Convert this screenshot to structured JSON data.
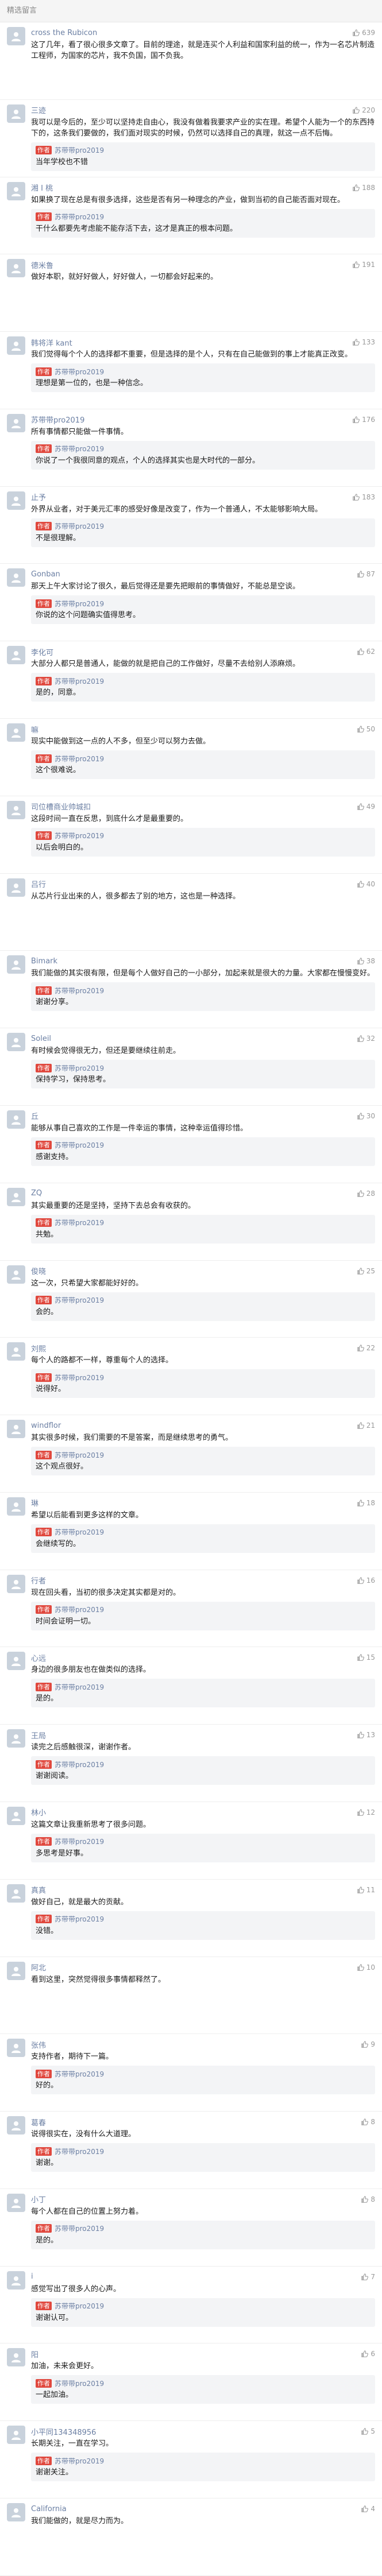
{
  "section_title": "精选留言",
  "reply_author_badge": "作者",
  "colors": {
    "link": "#6b7fa3",
    "badge": "#e0483e",
    "reply_bg": "#f3f4f6"
  },
  "comments": [
    {
      "name": "cross the Rubicon",
      "likes": "639",
      "text": "这了几年，看了很心很多文章了。目前的理途，就是连买个人利益和国家利益的统一，作为一名芯片制造工程师，为国家的芯片，我不负国，国不负我。",
      "reply": null
    },
    {
      "name": "三迹",
      "likes": "220",
      "text": "我可以是今后的，至少可以坚持走自由心，我没有做着我要求产业的实在理。希望个人能为一个的东西持下的，这条我们要做的，我们面对现实的时候，仍然可以选择自己的真理，就这一点不后悔。",
      "reply": {
        "name": "苏带带pro2019",
        "text": "当年学校也不错"
      }
    },
    {
      "name": "湘 I 桃",
      "likes": "188",
      "text": "如果换了现在总是有很多选择，这些是否有另一种理念的产业，做到当初的自己能否面对现在。",
      "reply": {
        "name": "苏带带pro2019",
        "text": "干什么都要先考虑能不能存活下去，这才是真正的根本问题。"
      }
    },
    {
      "name": "德米鲁",
      "likes": "191",
      "text": "做好本职，就好好做人，好好做人，一切都会好起来的。",
      "reply": null
    },
    {
      "name": "韩将洋 kant",
      "likes": "133",
      "text": "我们觉得每个个人的选择都不重要，但是选择的是个人，只有在自己能做到的事上才能真正改变。",
      "reply": {
        "name": "苏带带pro2019",
        "text": "理想是第一位的，也是一种信念。"
      }
    },
    {
      "name": "苏带带pro2019",
      "likes": "176",
      "text": "所有事情都只能做一件事情。",
      "reply": {
        "name": "苏带带pro2019",
        "text": "你说了一个我很同意的观点，个人的选择其实也是大时代的一部分。"
      }
    },
    {
      "name": "止予",
      "likes": "183",
      "text": "外界从业者，对于美元汇率的感受好像是改变了，作为一个普通人，不太能够影响大局。",
      "reply": {
        "name": "苏带带pro2019",
        "text": "不是很理解。"
      }
    },
    {
      "name": "Gonban",
      "likes": "87",
      "text": "那天上午大家讨论了很久，最后觉得还是要先把眼前的事情做好，不能总是空谈。",
      "reply": {
        "name": "苏带带pro2019",
        "text": "你说的这个问题确实值得思考。"
      }
    },
    {
      "name": "李化可",
      "likes": "62",
      "text": "大部分人都只是普通人，能做的就是把自己的工作做好，尽量不去给别人添麻烦。",
      "reply": {
        "name": "苏带带pro2019",
        "text": "是的，同意。"
      }
    },
    {
      "name": "嘛",
      "likes": "50",
      "text": "现实中能做到这一点的人不多，但至少可以努力去做。",
      "reply": {
        "name": "苏带带pro2019",
        "text": "这个很难说。"
      }
    },
    {
      "name": "司位槽商业帅城扣",
      "likes": "49",
      "text": "这段时间一直在反思，到底什么才是最重要的。",
      "reply": {
        "name": "苏带带pro2019",
        "text": "以后会明白的。"
      }
    },
    {
      "name": "吕行",
      "likes": "40",
      "text": "从芯片行业出来的人，很多都去了别的地方，这也是一种选择。",
      "reply": null
    },
    {
      "name": "Bimark",
      "likes": "38",
      "text": "我们能做的其实很有限，但是每个人做好自己的一小部分，加起来就是很大的力量。大家都在慢慢变好。",
      "reply": {
        "name": "苏带带pro2019",
        "text": "谢谢分享。"
      }
    },
    {
      "name": "Soleil",
      "likes": "32",
      "text": "有时候会觉得很无力，但还是要继续往前走。",
      "reply": {
        "name": "苏带带pro2019",
        "text": "保持学习，保持思考。"
      }
    },
    {
      "name": "丘",
      "likes": "30",
      "text": "能够从事自己喜欢的工作是一件幸运的事情，这种幸运值得珍惜。",
      "reply": {
        "name": "苏带带pro2019",
        "text": "感谢支持。"
      }
    },
    {
      "name": "ZQ",
      "likes": "28",
      "text": "其实最重要的还是坚持，坚持下去总会有收获的。",
      "reply": {
        "name": "苏带带pro2019",
        "text": "共勉。"
      }
    },
    {
      "name": "俊晓",
      "likes": "25",
      "text": "这一次，只希望大家都能好好的。",
      "reply": {
        "name": "苏带带pro2019",
        "text": "会的。"
      }
    },
    {
      "name": "刘熙",
      "likes": "22",
      "text": "每个人的路都不一样，尊重每个人的选择。",
      "reply": {
        "name": "苏带带pro2019",
        "text": "说得好。"
      }
    },
    {
      "name": "windflor",
      "likes": "21",
      "text": "其实很多时候，我们需要的不是答案，而是继续思考的勇气。",
      "reply": {
        "name": "苏带带pro2019",
        "text": "这个观点很好。"
      }
    },
    {
      "name": "琳",
      "likes": "18",
      "text": "希望以后能看到更多这样的文章。",
      "reply": {
        "name": "苏带带pro2019",
        "text": "会继续写的。"
      }
    },
    {
      "name": "行者",
      "likes": "16",
      "text": "现在回头看，当初的很多决定其实都是对的。",
      "reply": {
        "name": "苏带带pro2019",
        "text": "时间会证明一切。"
      }
    },
    {
      "name": "心远",
      "likes": "15",
      "text": "身边的很多朋友也在做类似的选择。",
      "reply": {
        "name": "苏带带pro2019",
        "text": "是的。"
      }
    },
    {
      "name": "王局",
      "likes": "13",
      "text": "读完之后感触很深，谢谢作者。",
      "reply": {
        "name": "苏带带pro2019",
        "text": "谢谢阅读。"
      }
    },
    {
      "name": "林小",
      "likes": "12",
      "text": "这篇文章让我重新思考了很多问题。",
      "reply": {
        "name": "苏带带pro2019",
        "text": "多思考是好事。"
      }
    },
    {
      "name": "真真",
      "likes": "11",
      "text": "做好自己，就是最大的贡献。",
      "reply": {
        "name": "苏带带pro2019",
        "text": "没错。"
      }
    },
    {
      "name": "阿北",
      "likes": "10",
      "text": "看到这里，突然觉得很多事情都释然了。",
      "reply": null
    },
    {
      "name": "张伟",
      "likes": "9",
      "text": "支持作者，期待下一篇。",
      "reply": {
        "name": "苏带带pro2019",
        "text": "好的。"
      }
    },
    {
      "name": "葛春",
      "likes": "8",
      "text": "说得很实在，没有什么大道理。",
      "reply": {
        "name": "苏带带pro2019",
        "text": "谢谢。"
      }
    },
    {
      "name": "小丁",
      "likes": "8",
      "text": "每个人都在自己的位置上努力着。",
      "reply": {
        "name": "苏带带pro2019",
        "text": "是的。"
      }
    },
    {
      "name": "i",
      "likes": "7",
      "text": "感觉写出了很多人的心声。",
      "reply": {
        "name": "苏带带pro2019",
        "text": "谢谢认可。"
      }
    },
    {
      "name": "阳",
      "likes": "6",
      "text": "加油，未来会更好。",
      "reply": {
        "name": "苏带带pro2019",
        "text": "一起加油。"
      }
    },
    {
      "name": "小平同134348956",
      "likes": "5",
      "text": "长期关注，一直在学习。",
      "reply": {
        "name": "苏带带pro2019",
        "text": "谢谢关注。"
      }
    },
    {
      "name": "California",
      "likes": "4",
      "text": "我们能做的，就是尽力而为。",
      "reply": null
    }
  ]
}
